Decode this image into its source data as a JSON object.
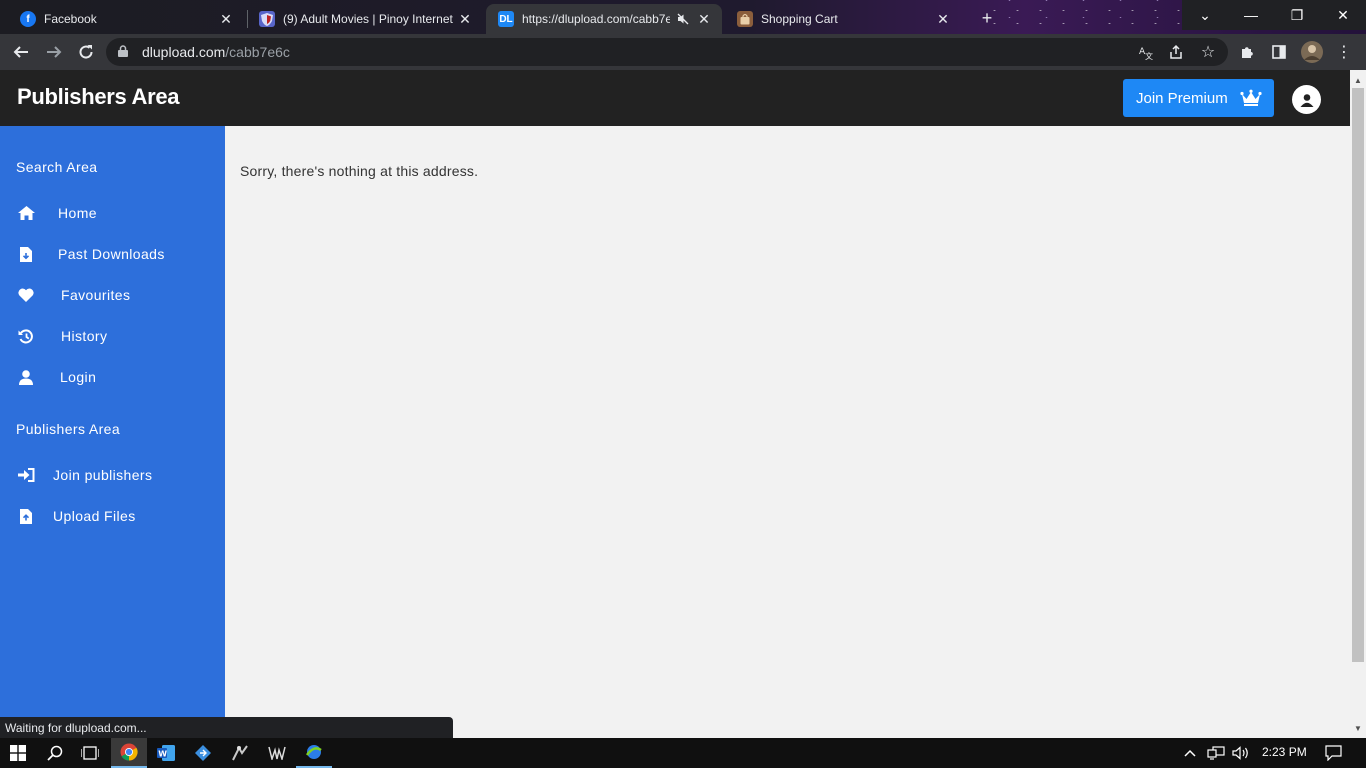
{
  "browser": {
    "tabs": [
      {
        "title": "Facebook",
        "favicon": "facebook-icon",
        "favicon_color": "#1877f2"
      },
      {
        "title": "(9) Adult Movies | Pinoy Internet",
        "favicon": "shield-icon",
        "favicon_color": "#5865c9"
      },
      {
        "title": "https://dlupload.com/cabb7e6c",
        "favicon": "dl-icon",
        "favicon_color": "#1e88f5",
        "favicon_text": "DL",
        "active": true,
        "muted": true
      },
      {
        "title": "Shopping Cart",
        "favicon": "bag-icon",
        "favicon_color": "#8b5e3c"
      }
    ],
    "url": {
      "host": "dlupload.com",
      "path": "/cabb7e6c"
    },
    "status_text": "Waiting for dlupload.com..."
  },
  "site": {
    "brand": "Publishers Area",
    "premium_label": "Join Premium",
    "accent": "#1e88f5",
    "sidebar_color": "#2d6fdb",
    "sidebar": {
      "search_section": "Search Area",
      "search_items": [
        {
          "label": "Home",
          "icon": "home-icon"
        },
        {
          "label": "Past Downloads",
          "icon": "file-download-icon"
        },
        {
          "label": "Favourites",
          "icon": "heart-icon"
        },
        {
          "label": "History",
          "icon": "history-icon"
        },
        {
          "label": "Login",
          "icon": "user-icon"
        }
      ],
      "publishers_section": "Publishers Area",
      "publisher_items": [
        {
          "label": "Join publishers",
          "icon": "sign-in-icon"
        },
        {
          "label": "Upload Files",
          "icon": "file-upload-icon"
        }
      ]
    },
    "message": "Sorry, there's nothing at this address."
  },
  "taskbar": {
    "clock": "2:23 PM"
  }
}
